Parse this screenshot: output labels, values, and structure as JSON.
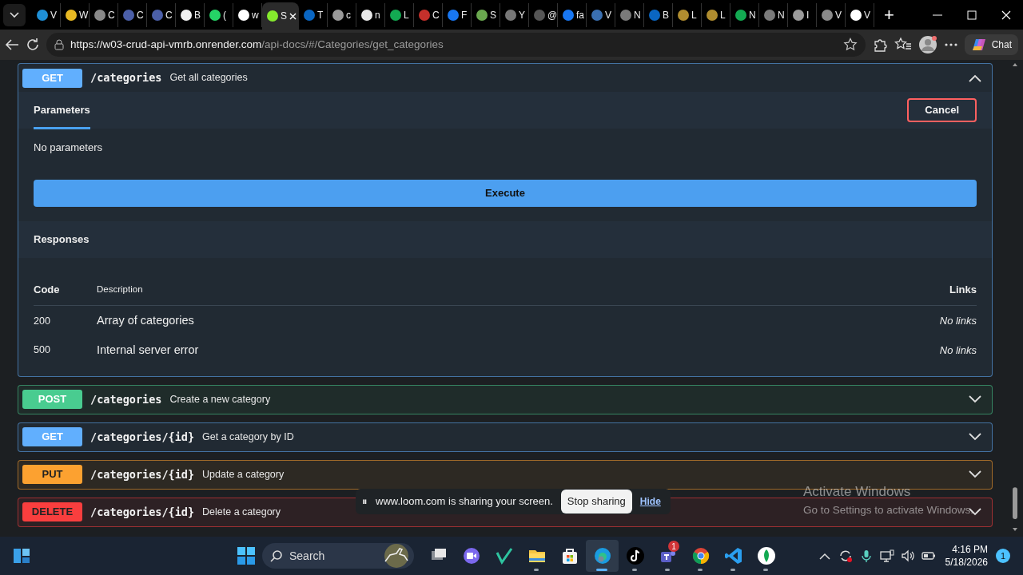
{
  "browser": {
    "tabs": [
      {
        "label": "V",
        "color": "#1f8fd6",
        "selected": false
      },
      {
        "label": "W",
        "color": "#e8b923",
        "selected": false
      },
      {
        "label": "C",
        "color": "#888888",
        "selected": false
      },
      {
        "label": "C",
        "color": "#4b5fa8",
        "selected": false
      },
      {
        "label": "C",
        "color": "#4b5fa8",
        "selected": false
      },
      {
        "label": "B",
        "color": "#f0f0f0",
        "selected": false
      },
      {
        "label": "(",
        "color": "#25d366",
        "selected": false
      },
      {
        "label": "w",
        "color": "#ffffff",
        "selected": false
      },
      {
        "label": "S",
        "color": "#85ea2d",
        "selected": true
      },
      {
        "label": "T",
        "color": "#0a66c2",
        "selected": false
      },
      {
        "label": "c",
        "color": "#9a9a9a",
        "selected": false
      },
      {
        "label": "n",
        "color": "#e8e8e8",
        "selected": false
      },
      {
        "label": "L",
        "color": "#13aa52",
        "selected": false
      },
      {
        "label": "C",
        "color": "#c4302b",
        "selected": false
      },
      {
        "label": "F",
        "color": "#1877f2",
        "selected": false
      },
      {
        "label": "S",
        "color": "#6aa84f",
        "selected": false
      },
      {
        "label": "Y",
        "color": "#777777",
        "selected": false
      },
      {
        "label": "@",
        "color": "#555555",
        "selected": false
      },
      {
        "label": "fa",
        "color": "#1877f2",
        "selected": false
      },
      {
        "label": "V",
        "color": "#3a6fb0",
        "selected": false
      },
      {
        "label": "N",
        "color": "#7a7a7a",
        "selected": false
      },
      {
        "label": "B",
        "color": "#0a66c2",
        "selected": false
      },
      {
        "label": "L",
        "color": "#b08d2f",
        "selected": false
      },
      {
        "label": "L",
        "color": "#b08d2f",
        "selected": false
      },
      {
        "label": "N",
        "color": "#13aa52",
        "selected": false
      },
      {
        "label": "N",
        "color": "#7a7a7a",
        "selected": false
      },
      {
        "label": "I",
        "color": "#9a9a9a",
        "selected": false
      },
      {
        "label": "V",
        "color": "#8a8a8a",
        "selected": false
      },
      {
        "label": "V",
        "color": "#ffffff",
        "selected": false
      }
    ],
    "new_tab": "+",
    "url": {
      "host": "https://w03-crud-api-vmrb.onrender.com",
      "path": "/api-docs/#/Categories/get_categories"
    },
    "chat_button": "Chat"
  },
  "operations": [
    {
      "method": "GET",
      "path": "/categories",
      "summary": "Get all categories",
      "color": "#61affe",
      "expanded": true,
      "details": {
        "parameters_tab": "Parameters",
        "cancel_button": "Cancel",
        "no_parameters": "No parameters",
        "execute_button": "Execute",
        "responses_title": "Responses",
        "columns": [
          "Code",
          "Description",
          "Links"
        ],
        "rows": [
          {
            "code": "200",
            "description": "Array of categories",
            "links": "No links"
          },
          {
            "code": "500",
            "description": "Internal server error",
            "links": "No links"
          }
        ]
      }
    },
    {
      "method": "POST",
      "path": "/categories",
      "summary": "Create a new category",
      "color": "#49cc90",
      "expanded": false
    },
    {
      "method": "GET",
      "path": "/categories/{id}",
      "summary": "Get a category by ID",
      "color": "#61affe",
      "expanded": false
    },
    {
      "method": "PUT",
      "path": "/categories/{id}",
      "summary": "Update a category",
      "color": "#fca130",
      "expanded": false
    },
    {
      "method": "DELETE",
      "path": "/categories/{id}",
      "summary": "Delete a category",
      "color": "#f93e3e",
      "expanded": false
    }
  ],
  "loom_banner": {
    "pause": "⏸",
    "text": "www.loom.com is sharing your screen.",
    "stop_button": "Stop sharing",
    "hide_link": "Hide"
  },
  "activation_notice": {
    "title": "Activate Windows",
    "subtitle": "Go to Settings to activate Windows."
  },
  "taskbar": {
    "search_placeholder": "Search",
    "apps": [
      {
        "kind": "taskview",
        "open": false,
        "selected": false
      },
      {
        "kind": "meet",
        "open": false,
        "selected": false
      },
      {
        "kind": "check",
        "open": false,
        "selected": false
      },
      {
        "kind": "folder",
        "open": true,
        "selected": false
      },
      {
        "kind": "store",
        "open": false,
        "selected": false
      },
      {
        "kind": "edge",
        "open": true,
        "selected": true
      },
      {
        "kind": "tiktok",
        "open": true,
        "selected": false
      },
      {
        "kind": "teams",
        "open": true,
        "selected": false,
        "badge": "1"
      },
      {
        "kind": "chrome",
        "open": true,
        "selected": false
      },
      {
        "kind": "vscode",
        "open": true,
        "selected": false
      },
      {
        "kind": "leaf",
        "open": true,
        "selected": false
      }
    ],
    "time": "4:16 PM",
    "date": "5/18/2026",
    "notifications": "1"
  }
}
